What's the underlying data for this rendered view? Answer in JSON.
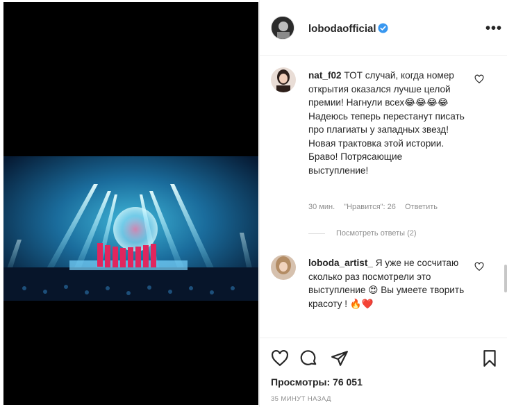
{
  "post": {
    "author": "lobodaofficial",
    "more_label": "•••"
  },
  "comments": [
    {
      "username": "nat_f02",
      "text": " ТОТ случай, когда номер открытия оказался лучше целой премии! Нагнули всех😂😂😂😂Надеюсь теперь перестанут писать про плагиаты у западных звезд! Новая трактовка этой истории. Браво! Потрясающие выступление!",
      "time": "30 мин.",
      "likes": "\"Нравится\": 26",
      "reply": "Ответить",
      "view_replies": "Посмотреть ответы (2)"
    },
    {
      "username": "loboda_artist_",
      "text": " Я уже не сосчитаю сколько раз посмотрели это выступление 😍 Вы умеете творить красоту ! 🔥❤️"
    }
  ],
  "stats": {
    "views_label": "Просмотры:",
    "views_value": "76 051",
    "posted_ago": "35 минут назад"
  },
  "colors": {
    "text": "#262626",
    "muted": "#8e8e8e",
    "verified": "#3897f0",
    "divider": "#efefef"
  },
  "icons": [
    "heart-icon",
    "comment-icon",
    "share-icon",
    "bookmark-icon",
    "verified-icon",
    "more-icon"
  ]
}
